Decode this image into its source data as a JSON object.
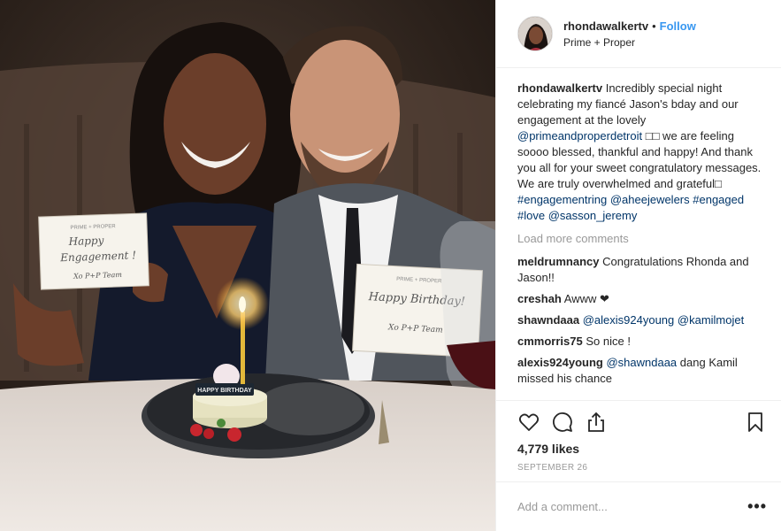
{
  "header": {
    "username": "rhondawalkertv",
    "separator": "•",
    "follow_label": "Follow",
    "location": "Prime + Proper"
  },
  "caption": {
    "username": "rhondawalkertv",
    "text_1": "Incredibly special night celebrating my fiancé Jason's bday and our engagement at the lovely",
    "mention_1": "@primeandproperdetroit",
    "text_2": "□□ we are feeling soooo blessed, thankful and happy! And thank you all for your sweet congratulatory messages. We are truly overwhelmed and grateful□",
    "hashtag_1": "#engagementring",
    "mention_2": "@aheejewelers",
    "hashtag_2": "#engaged",
    "hashtag_3": "#love",
    "mention_3": "@sasson_jeremy"
  },
  "load_more_label": "Load more comments",
  "comments": [
    {
      "user": "meldrumnancy",
      "text": "Congratulations Rhonda and Jason!!"
    },
    {
      "user": "creshah",
      "text": "Awww ❤"
    },
    {
      "user": "shawndaaa",
      "mention_a": "@alexis924young",
      "mention_b": "@kamilmojet"
    },
    {
      "user": "cmmorris75",
      "text": "So nice !"
    },
    {
      "user": "alexis924young",
      "mention": "@shawndaaa",
      "text": "dang Kamil missed his chance"
    }
  ],
  "actions": {
    "icons": [
      "heart-icon",
      "comment-icon",
      "share-icon",
      "bookmark-icon"
    ],
    "likes": "4,779 likes",
    "date": "SEPTEMBER 26"
  },
  "add_comment": {
    "placeholder": "Add a comment...",
    "more_label": "•••"
  },
  "photo": {
    "card_left_header": "PRIME + PROPER",
    "card_left_line1": "Happy",
    "card_left_line2": "Engagement !",
    "card_left_sign": "Xo P+P Team",
    "card_right_header": "PRIME + PROPER",
    "card_right_line1": "Happy Birthday!",
    "card_right_sign": "Xo P+P Team",
    "cake_plaque": "HAPPY BIRTHDAY"
  }
}
